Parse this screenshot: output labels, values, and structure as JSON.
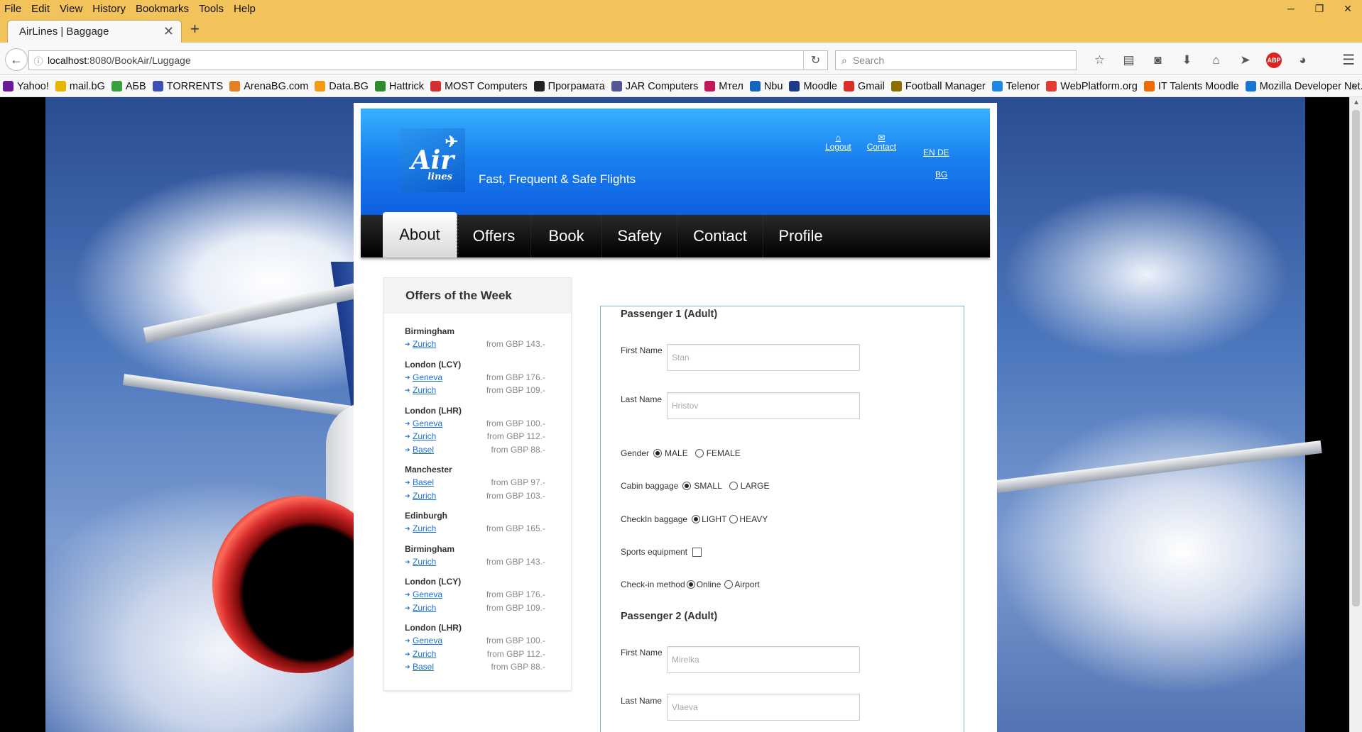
{
  "menubar": {
    "items": [
      "File",
      "Edit",
      "View",
      "History",
      "Bookmarks",
      "Tools",
      "Help"
    ]
  },
  "window_controls": {
    "minimize": "─",
    "maximize": "❐",
    "close": "✕"
  },
  "tab": {
    "title": "AirLines | Baggage",
    "close": "✕",
    "new_tab": "+"
  },
  "urlbar": {
    "host": "localhost",
    "rest": ":8080/BookAir/Luggage"
  },
  "searchbar": {
    "placeholder": "Search"
  },
  "browser_icons": [
    "star-icon",
    "reading-list-icon",
    "pocket-icon",
    "download-icon",
    "home-icon",
    "send-icon",
    "adblock-icon",
    "extension-icon"
  ],
  "abp_label": "ABP",
  "bookmarks": [
    {
      "label": "Yahoo!",
      "color": "#6a1b9a"
    },
    {
      "label": "mail.bG",
      "color": "#e8b400"
    },
    {
      "label": "АБВ",
      "color": "#3aa03a"
    },
    {
      "label": "TORRENTS",
      "color": "#3f51b5"
    },
    {
      "label": "ArenaBG.com",
      "color": "#e67e22"
    },
    {
      "label": "Data.BG",
      "color": "#f39c12"
    },
    {
      "label": "Hattrick",
      "color": "#2e8b2e"
    },
    {
      "label": "MOST Computers",
      "color": "#d32f2f"
    },
    {
      "label": "Програмата",
      "color": "#222222"
    },
    {
      "label": "JAR Computers",
      "color": "#555599"
    },
    {
      "label": "Мтел",
      "color": "#c2185b"
    },
    {
      "label": "Nbu",
      "color": "#1565c0"
    },
    {
      "label": "Moodle",
      "color": "#1e3a8a"
    },
    {
      "label": "Gmail",
      "color": "#d93025"
    },
    {
      "label": "Football Manager",
      "color": "#8d6e00"
    },
    {
      "label": "Telenor",
      "color": "#1e88e5"
    },
    {
      "label": "WebPlatform.org",
      "color": "#e53935"
    },
    {
      "label": "IT Talents Moodle",
      "color": "#ef6c00"
    },
    {
      "label": "Mozilla Developer Net...",
      "color": "#1976d2"
    }
  ],
  "bookmarks_more": "»",
  "site": {
    "tagline": "Fast, Frequent & Safe Flights",
    "logo_text": "Air",
    "logo_sub": "lines",
    "top_links": [
      {
        "label": "Logout",
        "icon": "⌂"
      },
      {
        "label": "Contact",
        "icon": "✉"
      }
    ],
    "lang_line1": "EN DE",
    "lang_line2": "BG",
    "nav": [
      "About",
      "Offers",
      "Book",
      "Safety",
      "Contact",
      "Profile"
    ],
    "sidebar": {
      "title": "Offers of the Week",
      "groups": [
        {
          "origin": "Birmingham",
          "routes": [
            {
              "dest": "Zurich",
              "price": "from GBP 143.-"
            }
          ]
        },
        {
          "origin": "London (LCY)",
          "routes": [
            {
              "dest": "Geneva",
              "price": "from GBP 176.-"
            },
            {
              "dest": "Zurich",
              "price": "from GBP 109.-"
            }
          ]
        },
        {
          "origin": "London (LHR)",
          "routes": [
            {
              "dest": "Geneva",
              "price": "from GBP 100.-"
            },
            {
              "dest": "Zurich",
              "price": "from GBP 112.-"
            },
            {
              "dest": "Basel",
              "price": "from GBP 88.-"
            }
          ]
        },
        {
          "origin": "Manchester",
          "routes": [
            {
              "dest": "Basel",
              "price": "from GBP 97.-"
            },
            {
              "dest": "Zurich",
              "price": "from GBP 103.-"
            }
          ]
        },
        {
          "origin": "Edinburgh",
          "routes": [
            {
              "dest": "Zurich",
              "price": "from GBP 165.-"
            }
          ]
        },
        {
          "origin": "Birmingham",
          "routes": [
            {
              "dest": "Zurich",
              "price": "from GBP 143.-"
            }
          ]
        },
        {
          "origin": "London (LCY)",
          "routes": [
            {
              "dest": "Geneva",
              "price": "from GBP 176.-"
            },
            {
              "dest": "Zurich",
              "price": "from GBP 109.-"
            }
          ]
        },
        {
          "origin": "London (LHR)",
          "routes": [
            {
              "dest": "Geneva",
              "price": "from GBP 100.-"
            },
            {
              "dest": "Zurich",
              "price": "from GBP 112.-"
            },
            {
              "dest": "Basel",
              "price": "from GBP 88.-"
            }
          ]
        }
      ]
    },
    "form": {
      "p1_title": "Passenger 1 (Adult)",
      "first_name_label": "First Name",
      "first_name_value": "Stan",
      "last_name_label": "Last Name",
      "last_name_value": "Hristov",
      "gender_label": "Gender",
      "gender_male": "MALE",
      "gender_female": "FEMALE",
      "cabin_label": "Cabin baggage",
      "cabin_small": "SMALL",
      "cabin_large": "LARGE",
      "checkin_bag_label": "CheckIn baggage",
      "checkin_light": "LIGHT",
      "checkin_heavy": "HEAVY",
      "sports_label": "Sports equipment",
      "method_label": "Check-in method",
      "method_online": "Online",
      "method_airport": "Airport",
      "p2_title": "Passenger 2 (Adult)",
      "p2_first_value": "Mirelka",
      "p2_last_value": "Vlaeva"
    }
  }
}
